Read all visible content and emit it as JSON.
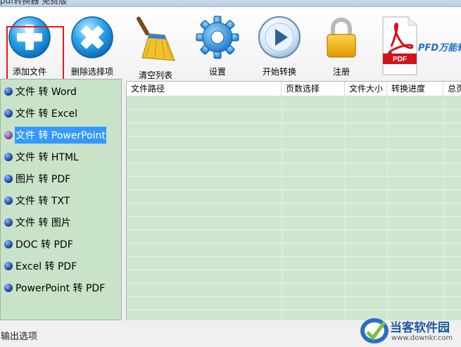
{
  "window": {
    "title": "pdf转换器 免费版"
  },
  "toolbar": {
    "items": [
      {
        "label": "添加文件",
        "icon": "add-icon"
      },
      {
        "label": "删除选择项",
        "icon": "delete-icon"
      },
      {
        "label": "清空列表",
        "icon": "broom-icon"
      },
      {
        "label": "设置",
        "icon": "gear-icon"
      },
      {
        "label": "开始转换",
        "icon": "play-icon"
      },
      {
        "label": "注册",
        "icon": "lock-icon"
      }
    ],
    "brand_text": "PFD万能转",
    "brand_badge": "PDF",
    "highlight_color": "#e01b1b"
  },
  "sidebar": {
    "items": [
      {
        "label": "文件 转 Word"
      },
      {
        "label": "文件 转 Excel"
      },
      {
        "label": "文件 转 PowerPoint",
        "selected": true
      },
      {
        "label": "文件 转 HTML"
      },
      {
        "label": "图片 转 PDF"
      },
      {
        "label": "文件 转 TXT"
      },
      {
        "label": "文件 转 图片"
      },
      {
        "label": "DOC 转 PDF"
      },
      {
        "label": "Excel 转 PDF"
      },
      {
        "label": "PowerPoint 转 PDF"
      }
    ]
  },
  "grid": {
    "columns": [
      {
        "label": "文件路径"
      },
      {
        "label": "页数选择"
      },
      {
        "label": "文件大小"
      },
      {
        "label": "转换进度"
      },
      {
        "label": "总页"
      }
    ]
  },
  "output": {
    "label": "输出选项"
  },
  "watermark": {
    "main": "当客软件园",
    "sub": "www.downkr.com"
  }
}
